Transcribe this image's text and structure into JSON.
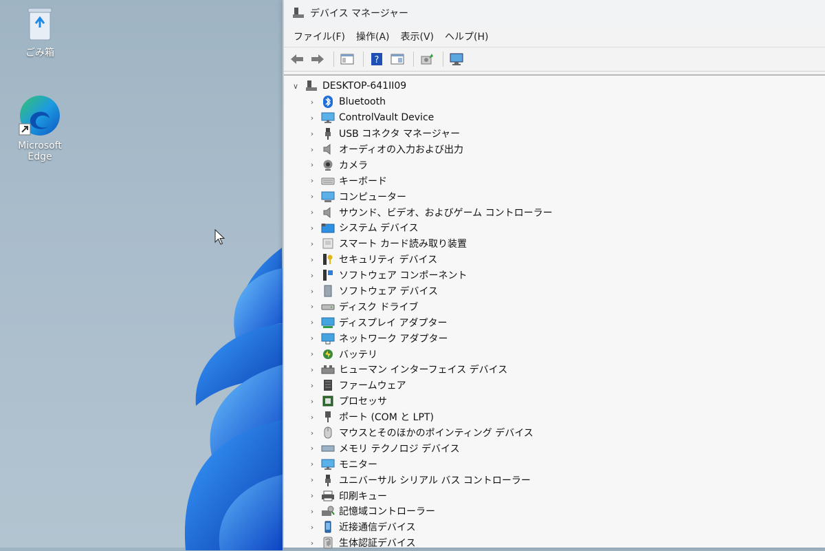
{
  "desktop": {
    "recycle_bin_label": "ごみ箱",
    "edge_label_line1": "Microsoft",
    "edge_label_line2": "Edge"
  },
  "window": {
    "title": "デバイス マネージャー",
    "menu": [
      "ファイル(F)",
      "操作(A)",
      "表示(V)",
      "ヘルプ(H)"
    ],
    "root": "DESKTOP-641II09",
    "categories": [
      {
        "label": "Bluetooth",
        "icon": "bluetooth-icon"
      },
      {
        "label": "ControlVault Device",
        "icon": "monitor-icon"
      },
      {
        "label": "USB コネクタ マネージャー",
        "icon": "usb-plug-icon"
      },
      {
        "label": "オーディオの入力および出力",
        "icon": "speaker-icon"
      },
      {
        "label": "カメラ",
        "icon": "camera-icon"
      },
      {
        "label": "キーボード",
        "icon": "keyboard-icon"
      },
      {
        "label": "コンピューター",
        "icon": "computer-icon"
      },
      {
        "label": "サウンド、ビデオ、およびゲーム コントローラー",
        "icon": "speaker-icon"
      },
      {
        "label": "システム デバイス",
        "icon": "folder-icon"
      },
      {
        "label": "スマート カード読み取り装置",
        "icon": "card-reader-icon"
      },
      {
        "label": "セキュリティ デバイス",
        "icon": "security-key-icon"
      },
      {
        "label": "ソフトウェア コンポーネント",
        "icon": "software-component-icon"
      },
      {
        "label": "ソフトウェア デバイス",
        "icon": "software-device-icon"
      },
      {
        "label": "ディスク ドライブ",
        "icon": "disk-drive-icon"
      },
      {
        "label": "ディスプレイ アダプター",
        "icon": "display-adapter-icon"
      },
      {
        "label": "ネットワーク アダプター",
        "icon": "network-adapter-icon"
      },
      {
        "label": "バッテリ",
        "icon": "battery-icon"
      },
      {
        "label": "ヒューマン インターフェイス デバイス",
        "icon": "hid-icon"
      },
      {
        "label": "ファームウェア",
        "icon": "firmware-icon"
      },
      {
        "label": "プロセッサ",
        "icon": "processor-icon"
      },
      {
        "label": "ポート (COM と LPT)",
        "icon": "port-icon"
      },
      {
        "label": "マウスとそのほかのポインティング デバイス",
        "icon": "mouse-icon"
      },
      {
        "label": "メモリ テクノロジ デバイス",
        "icon": "memory-icon"
      },
      {
        "label": "モニター",
        "icon": "monitor-icon"
      },
      {
        "label": "ユニバーサル シリアル バス コントローラー",
        "icon": "usb-plug-icon"
      },
      {
        "label": "印刷キュー",
        "icon": "printer-icon"
      },
      {
        "label": "記憶域コントローラー",
        "icon": "storage-controller-icon"
      },
      {
        "label": "近接通信デバイス",
        "icon": "proximity-icon"
      },
      {
        "label": "生体認証デバイス",
        "icon": "biometric-icon"
      }
    ]
  },
  "colors": {
    "accent_blue": "#1e6fd9",
    "bloom_blue": "#1565e0"
  }
}
